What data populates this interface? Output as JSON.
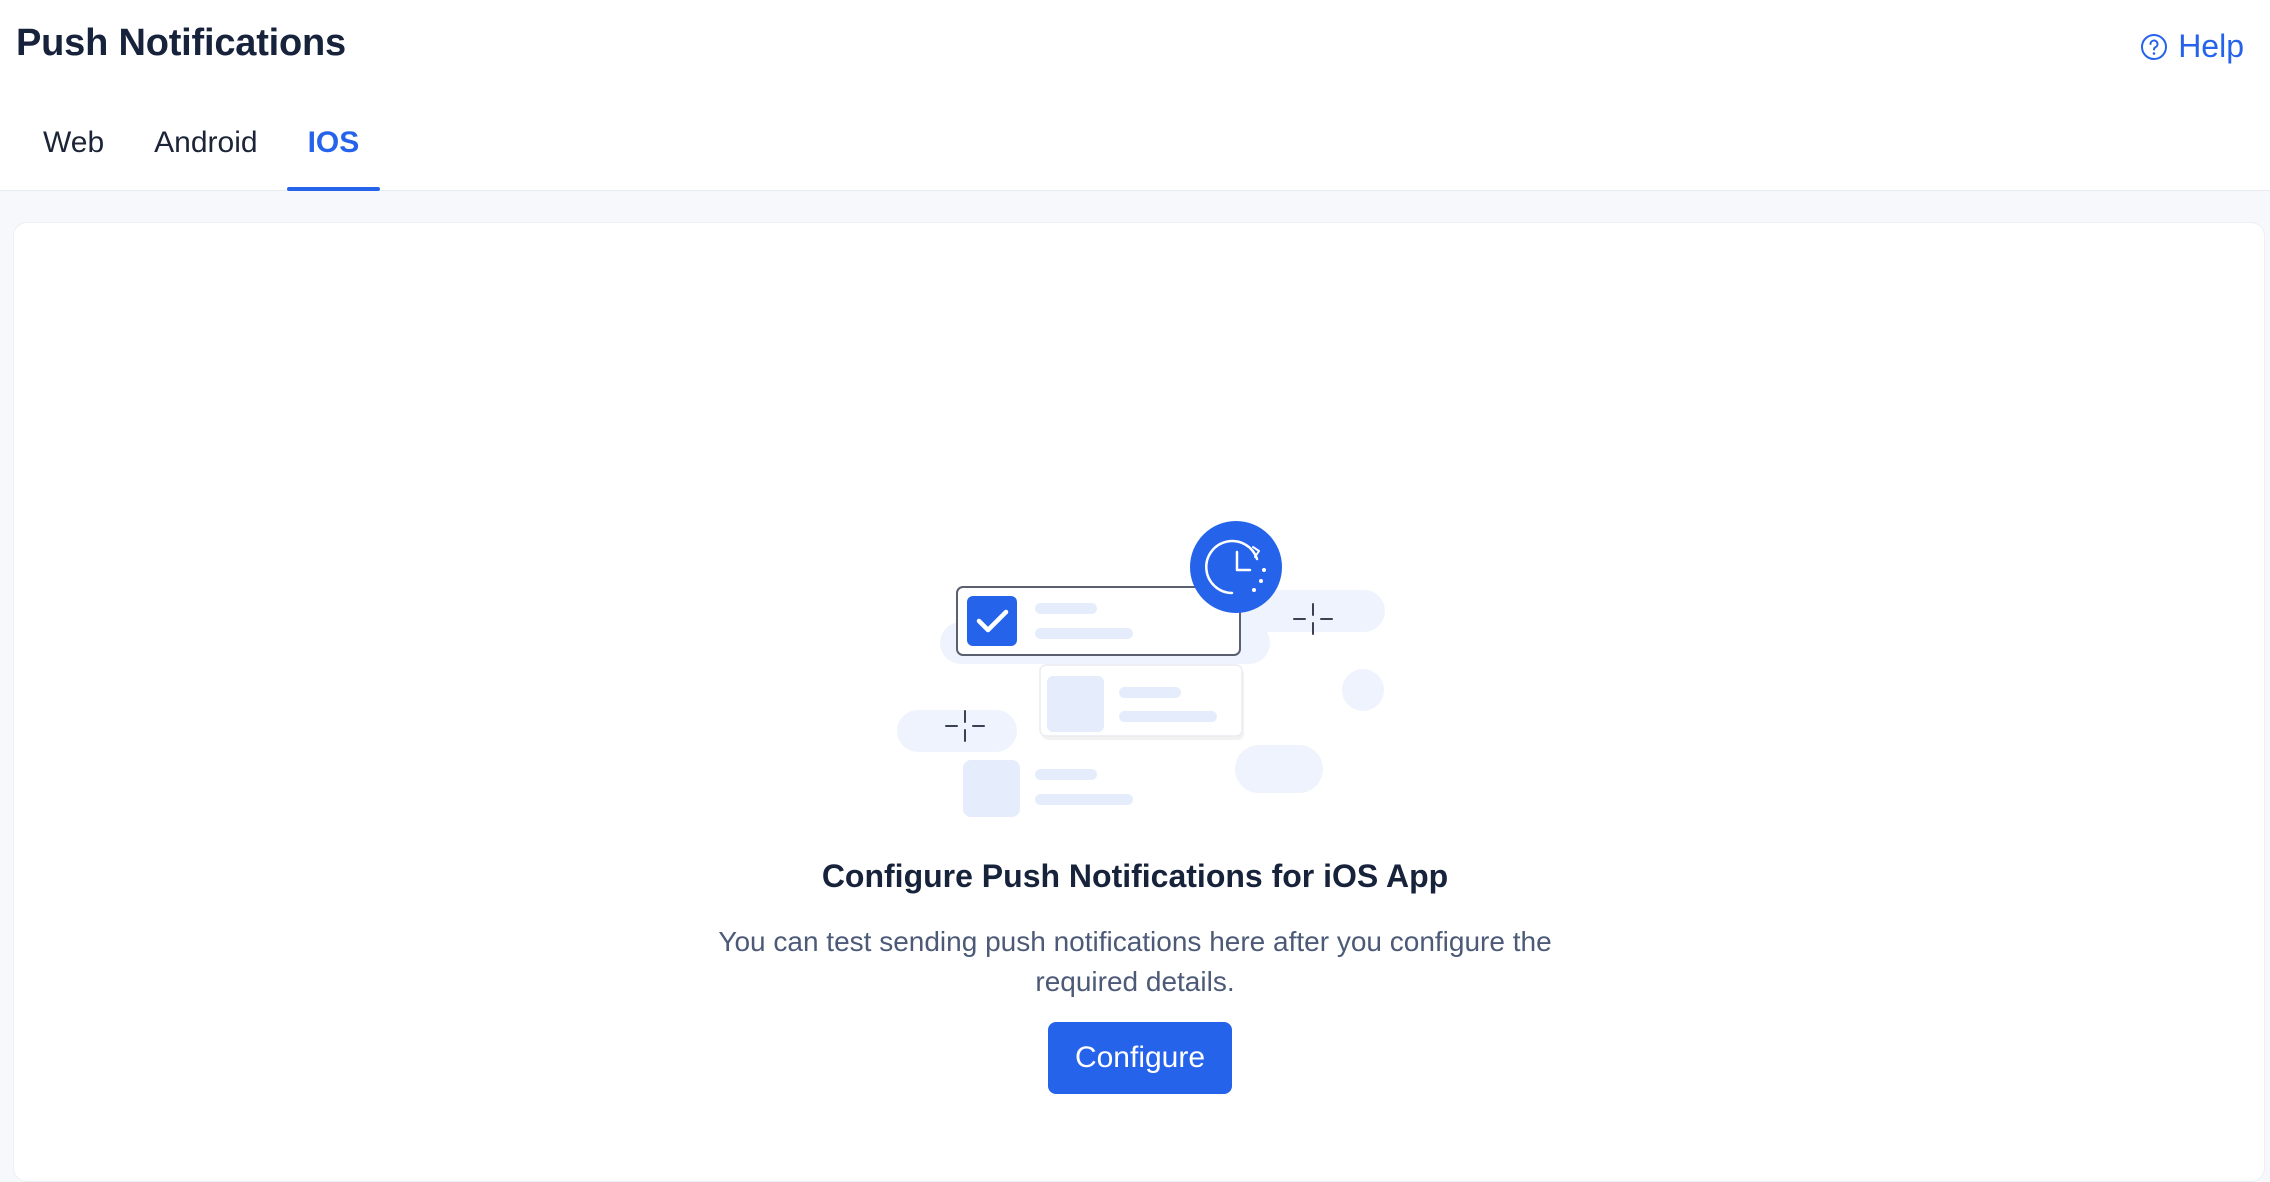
{
  "header": {
    "title": "Push Notifications",
    "help_label": "Help",
    "help_icon": "help-circle-icon"
  },
  "tabs": [
    {
      "label": "Web",
      "active": false
    },
    {
      "label": "Android",
      "active": false
    },
    {
      "label": "IOS",
      "active": true
    }
  ],
  "empty_state": {
    "illustration": "push-notification-illustration",
    "title": "Configure Push Notifications for iOS App",
    "description": "You can test sending push notifications here after you configure the required details.",
    "button_label": "Configure"
  },
  "colors": {
    "accent": "#2563eb",
    "title_text": "#17223b",
    "body_text": "#4c5a78",
    "illustration_light": "#eef3fd"
  }
}
